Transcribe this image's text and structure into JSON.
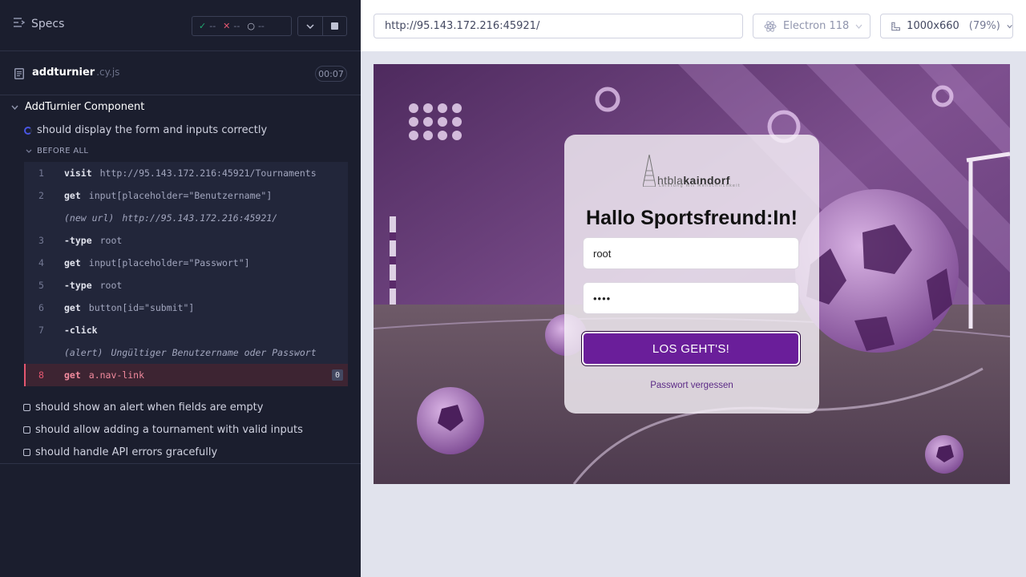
{
  "reporter": {
    "header": {
      "title": "Specs",
      "passed": "--",
      "failed": "--",
      "pending": "--"
    },
    "file": {
      "name": "addturnier",
      "ext": ".cy.js",
      "duration": "00:07"
    },
    "suite": "AddTurnier Component",
    "running_test": "should display the form and inputs correctly",
    "hook": "BEFORE ALL",
    "commands": [
      {
        "num": "1",
        "name": "visit",
        "message": "http://95.143.172.216:45921/Tournaments"
      },
      {
        "num": "2",
        "name": "get",
        "message": "input[placeholder=\"Benutzername\"]"
      },
      {
        "num": "",
        "name": "(new url)",
        "message": "http://95.143.172.216:45921/"
      },
      {
        "num": "3",
        "name": "-type",
        "message": "root"
      },
      {
        "num": "4",
        "name": "get",
        "message": "input[placeholder=\"Passwort\"]"
      },
      {
        "num": "5",
        "name": "-type",
        "message": "root"
      },
      {
        "num": "6",
        "name": "get",
        "message": "button[id=\"submit\"]"
      },
      {
        "num": "7",
        "name": "-click",
        "message": ""
      },
      {
        "num": "",
        "name": "(alert)",
        "message": "Ungültiger Benutzername oder Passwort"
      },
      {
        "num": "8",
        "name": "get",
        "message": "a.nav-link",
        "count": "0"
      }
    ],
    "tests": [
      "should show an alert when fields are empty",
      "should allow adding a tournament with valid inputs",
      "should handle API errors gracefully"
    ]
  },
  "aut": {
    "url": "http://95.143.172.216:45921/",
    "browser": "Electron 118",
    "viewport": "1000x660",
    "scale": "(79%)",
    "page": {
      "logo_light": "htbla",
      "logo_bold": "kaindorf",
      "logo_tagline": "Leistung mit Menschlichkeit",
      "greeting": "Hallo Sportsfreund:In!",
      "username_value": "root",
      "password_value": "••••",
      "submit_label": "LOS GEHT'S!",
      "forgot_link": "Passwort vergessen"
    }
  },
  "colors": {
    "reporter_bg": "#1b1e2e",
    "accent_purple": "#6a1e9a",
    "failed": "#e45770",
    "passed": "#1fa971"
  }
}
